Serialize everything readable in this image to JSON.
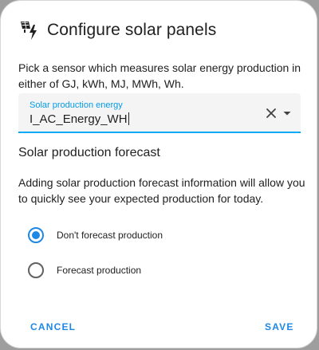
{
  "dialog": {
    "title": "Configure solar panels",
    "icon": "solar-power-icon",
    "description": "Pick a sensor which measures solar energy production in either of GJ, kWh, MJ, MWh, Wh."
  },
  "field": {
    "label": "Solar production energy",
    "value": "I_AC_Energy_WH",
    "clear_icon": "close-icon",
    "dropdown_icon": "chevron-down-icon"
  },
  "forecast": {
    "title": "Solar production forecast",
    "info": "Adding solar production forecast information will allow you to quickly see your expected production for today.",
    "options": [
      {
        "label": "Don't forecast production",
        "selected": true
      },
      {
        "label": "Forecast production",
        "selected": false
      }
    ]
  },
  "actions": {
    "cancel": "CANCEL",
    "save": "SAVE"
  },
  "colors": {
    "accent": "#1e88e5",
    "field_underline": "#03a9f4",
    "text": "#212121"
  }
}
